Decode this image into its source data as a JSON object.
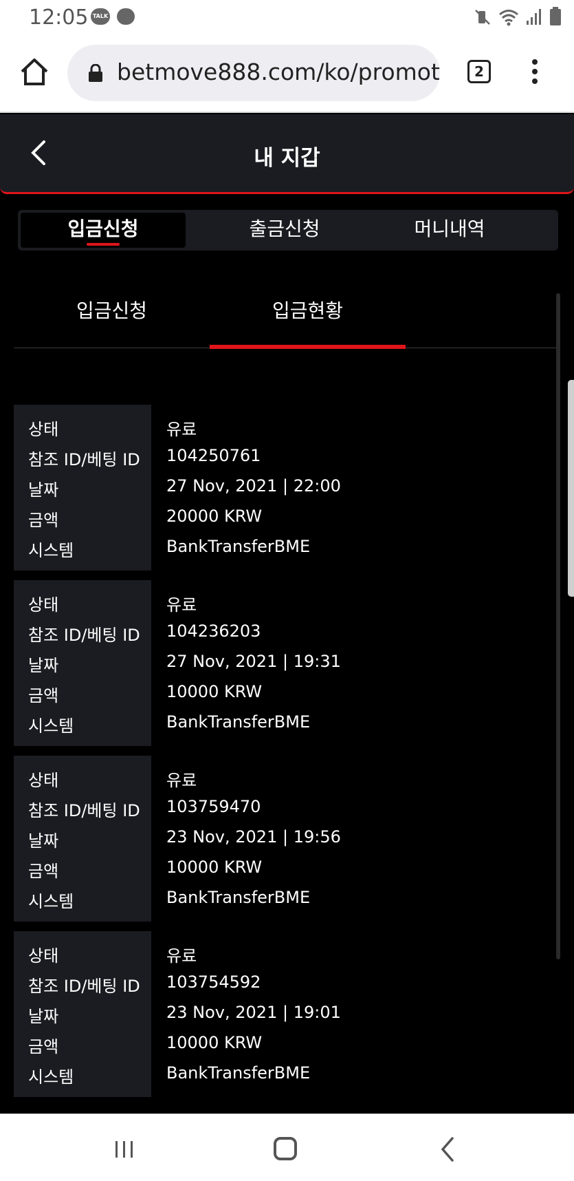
{
  "status_bar": {
    "time": "12:05",
    "talk_badge": "TALK",
    "icons": [
      "talk-icon",
      "chat-bubble-icon",
      "mute-vibrate-icon",
      "wifi-icon",
      "signal-icon",
      "battery-icon"
    ]
  },
  "browser": {
    "url": "betmove888.com/ko/promot",
    "tab_count": "2",
    "icons": [
      "home-icon",
      "lock-icon",
      "more-menu-icon"
    ]
  },
  "app": {
    "title": "내 지갑",
    "accent_color": "#e0151b"
  },
  "main_tabs": [
    {
      "label": "입금신청",
      "active": true
    },
    {
      "label": "출금신청",
      "active": false
    },
    {
      "label": "머니내역",
      "active": false
    }
  ],
  "sub_tabs": [
    {
      "label": "입금신청",
      "active": false
    },
    {
      "label": "입금현황",
      "active": true
    }
  ],
  "field_labels": {
    "status": "상태",
    "ref_id": "참조 ID/베팅 ID",
    "date": "날짜",
    "amount": "금액",
    "system": "시스템"
  },
  "records": [
    {
      "status": "유료",
      "ref_id": "104250761",
      "date": "27 Nov, 2021 | 22:00",
      "amount": "20000 KRW",
      "system": "BankTransferBME"
    },
    {
      "status": "유료",
      "ref_id": "104236203",
      "date": "27 Nov, 2021 | 19:31",
      "amount": "10000 KRW",
      "system": "BankTransferBME"
    },
    {
      "status": "유료",
      "ref_id": "103759470",
      "date": "23 Nov, 2021 | 19:56",
      "amount": "10000 KRW",
      "system": "BankTransferBME"
    },
    {
      "status": "유료",
      "ref_id": "103754592",
      "date": "23 Nov, 2021 | 19:01",
      "amount": "10000 KRW",
      "system": "BankTransferBME"
    }
  ]
}
